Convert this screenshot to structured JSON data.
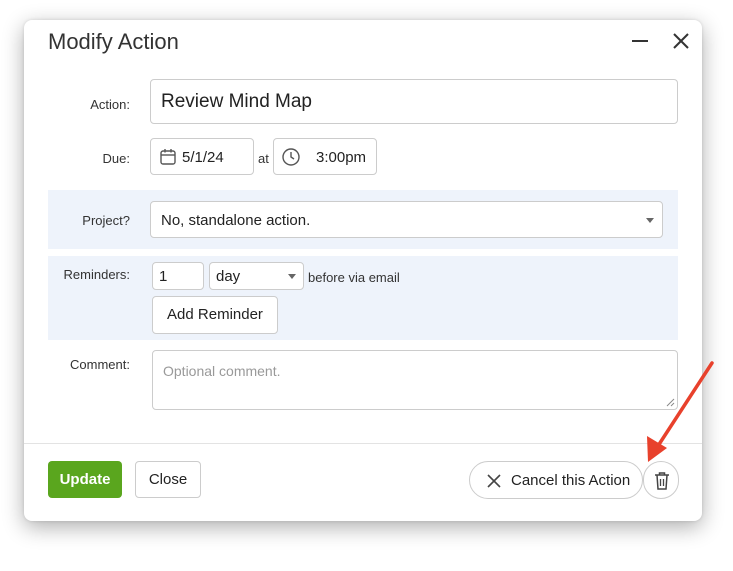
{
  "dialog": {
    "title": "Modify Action"
  },
  "form": {
    "action_label": "Action:",
    "action_value": "Review Mind Map",
    "due_label": "Due:",
    "due_date": "5/1/24",
    "at_label": "at",
    "due_time": "3:00pm",
    "project_label": "Project?",
    "project_value": "No, standalone action.",
    "reminders_label": "Reminders:",
    "reminder_count": "1",
    "reminder_unit": "day",
    "reminder_suffix": "before via email",
    "add_reminder": "Add Reminder",
    "comment_label": "Comment:",
    "comment_placeholder": "Optional comment."
  },
  "footer": {
    "update": "Update",
    "close": "Close",
    "cancel_action": "Cancel this Action"
  },
  "colors": {
    "primary_green": "#5aa61e",
    "band_blue": "#eef3fb",
    "annotation_arrow": "#e8412c"
  },
  "icons": [
    "minimize-icon",
    "close-icon",
    "calendar-icon",
    "clock-icon",
    "chevron-down-icon",
    "x-icon",
    "trash-icon",
    "resize-handle-icon"
  ]
}
